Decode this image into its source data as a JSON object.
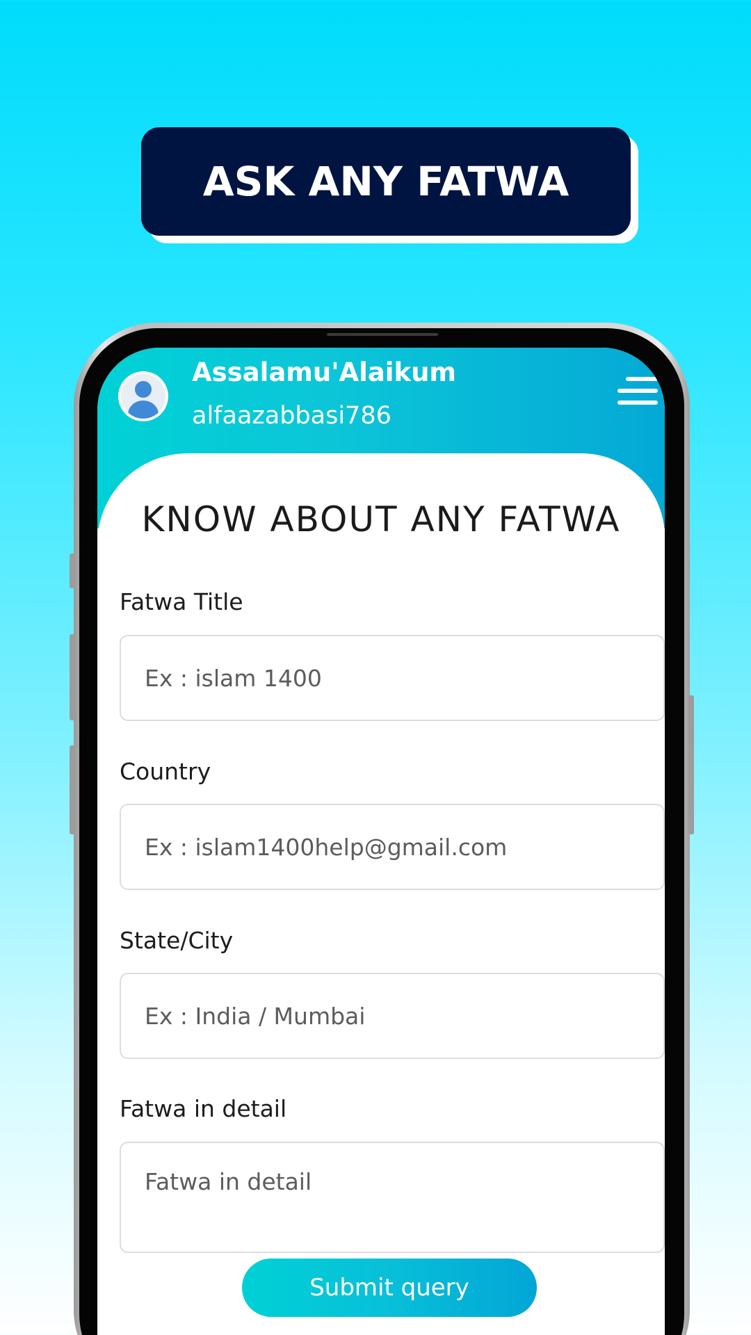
{
  "banner": {
    "title": "ASK ANY FATWA"
  },
  "header": {
    "greeting": "Assalamu'Alaikum",
    "username": "alfaazabbasi786"
  },
  "form": {
    "title": "KNOW ABOUT ANY FATWA",
    "fields": [
      {
        "label": "Fatwa Title",
        "placeholder": "Ex : islam 1400"
      },
      {
        "label": "Country",
        "placeholder": "Ex : islam1400help@gmail.com"
      },
      {
        "label": "State/City",
        "placeholder": "Ex : India / Mumbai"
      },
      {
        "label": "Fatwa in detail",
        "placeholder": "Fatwa in detail"
      }
    ],
    "submit_label": "Submit query"
  },
  "colors": {
    "banner_bg": "#001442",
    "header_gradient_start": "#00d1d6",
    "header_gradient_end": "#04a9d6",
    "page_bg_top": "#00dcfc"
  }
}
